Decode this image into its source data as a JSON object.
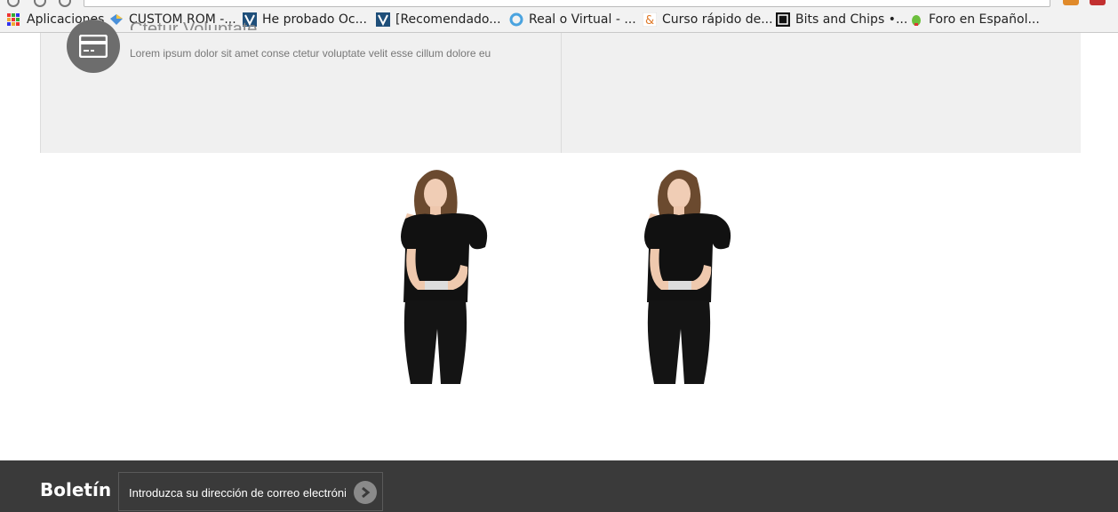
{
  "bookmarks_bar": {
    "items": [
      {
        "label": "Aplicaciones",
        "icon": "apps-grid-icon"
      },
      {
        "label": "CUSTOM ROM -...",
        "icon": "diamond-icon"
      },
      {
        "label": "He probado Oc...",
        "icon": "site-v-icon"
      },
      {
        "label": "[Recomendado...",
        "icon": "site-v-icon"
      },
      {
        "label": "Real o Virtual - ...",
        "icon": "circle-refresh-icon"
      },
      {
        "label": "Curso rápido de...",
        "icon": "ampersand-icon"
      },
      {
        "label": "Bits and Chips •...",
        "icon": "bc-logo-icon"
      },
      {
        "label": "Foro en Español...",
        "icon": "android-icon"
      }
    ]
  },
  "feature": {
    "title": "Ctetur Voluptate",
    "text": "Lorem ipsum dolor sit amet conse ctetur voluptate velit esse cillum dolore eu",
    "icon": "credit-card-icon"
  },
  "products": [
    {
      "image": "model-black-top-photo"
    },
    {
      "image": "model-black-top-photo"
    }
  ],
  "footer": {
    "newsletter_title": "Boletín",
    "newsletter_placeholder": "Introduzca su dirección de correo electrónico",
    "submit_icon": "chevron-right-icon"
  },
  "colors": {
    "panel_bg": "#f0f0f0",
    "footer_bg": "#3a3a3a",
    "icon_circle": "#6d6d6d"
  }
}
